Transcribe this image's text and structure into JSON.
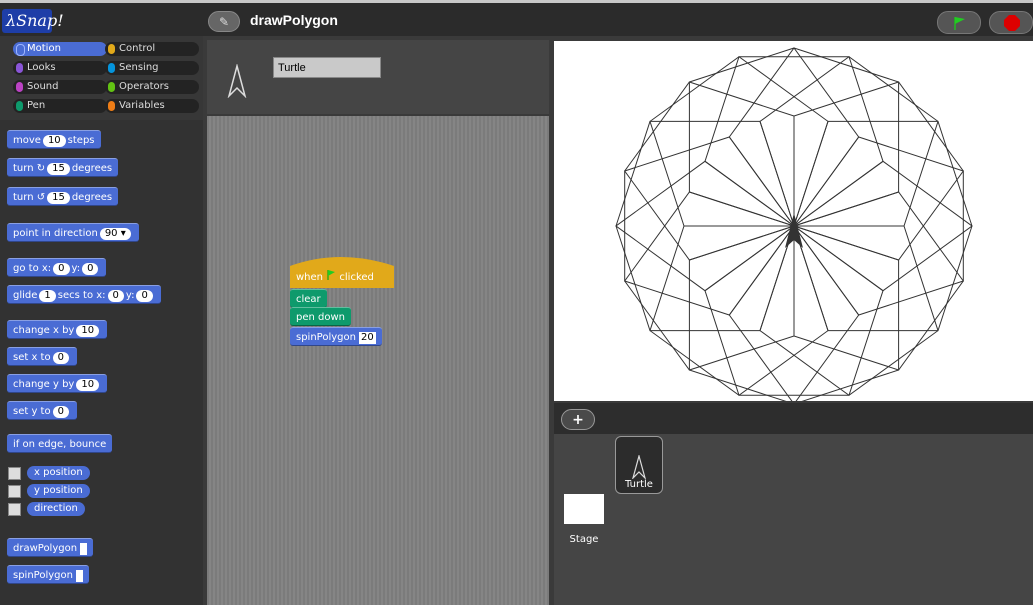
{
  "app": {
    "logo_text": "λSnap!",
    "project_title": "drawPolygon"
  },
  "categories": [
    {
      "label": "Motion",
      "color": "#4a6cd4",
      "selected": true
    },
    {
      "label": "Control",
      "color": "#e1a91a"
    },
    {
      "label": "Looks",
      "color": "#8a55d7"
    },
    {
      "label": "Sensing",
      "color": "#0494dc"
    },
    {
      "label": "Sound",
      "color": "#bb42c3"
    },
    {
      "label": "Operators",
      "color": "#62c213"
    },
    {
      "label": "Pen",
      "color": "#0e9a6c"
    },
    {
      "label": "Variables",
      "color": "#ee7d16"
    }
  ],
  "palette": {
    "move": {
      "pre": "move",
      "val": "10",
      "post": "steps"
    },
    "turn_cw": {
      "pre": "turn ↻",
      "val": "15",
      "post": "degrees"
    },
    "turn_ccw": {
      "pre": "turn ↺",
      "val": "15",
      "post": "degrees"
    },
    "point": {
      "pre": "point in direction",
      "val": "90 ▾"
    },
    "goto": {
      "pre": "go to x:",
      "x": "0",
      "mid": "y:",
      "y": "0"
    },
    "glide": {
      "pre": "glide",
      "secs": "1",
      "mid1": "secs to x:",
      "x": "0",
      "mid2": "y:",
      "y": "0"
    },
    "change_x": {
      "pre": "change x by",
      "val": "10"
    },
    "set_x": {
      "pre": "set x to",
      "val": "0"
    },
    "change_y": {
      "pre": "change y by",
      "val": "10"
    },
    "set_y": {
      "pre": "set y to",
      "val": "0"
    },
    "bounce": "if on edge, bounce",
    "reporters": [
      "x position",
      "y position",
      "direction"
    ],
    "custom": [
      "drawPolygon",
      "spinPolygon"
    ]
  },
  "sprite": {
    "name": "Turtle"
  },
  "script": {
    "hat_pre": "when",
    "hat_post": "clicked",
    "clear": "clear",
    "pen_down": "pen down",
    "spin": "spinPolygon",
    "spin_arg": "20"
  },
  "corral": {
    "sprite_label": "Turtle",
    "stage_label": "Stage",
    "add_button": "+"
  }
}
